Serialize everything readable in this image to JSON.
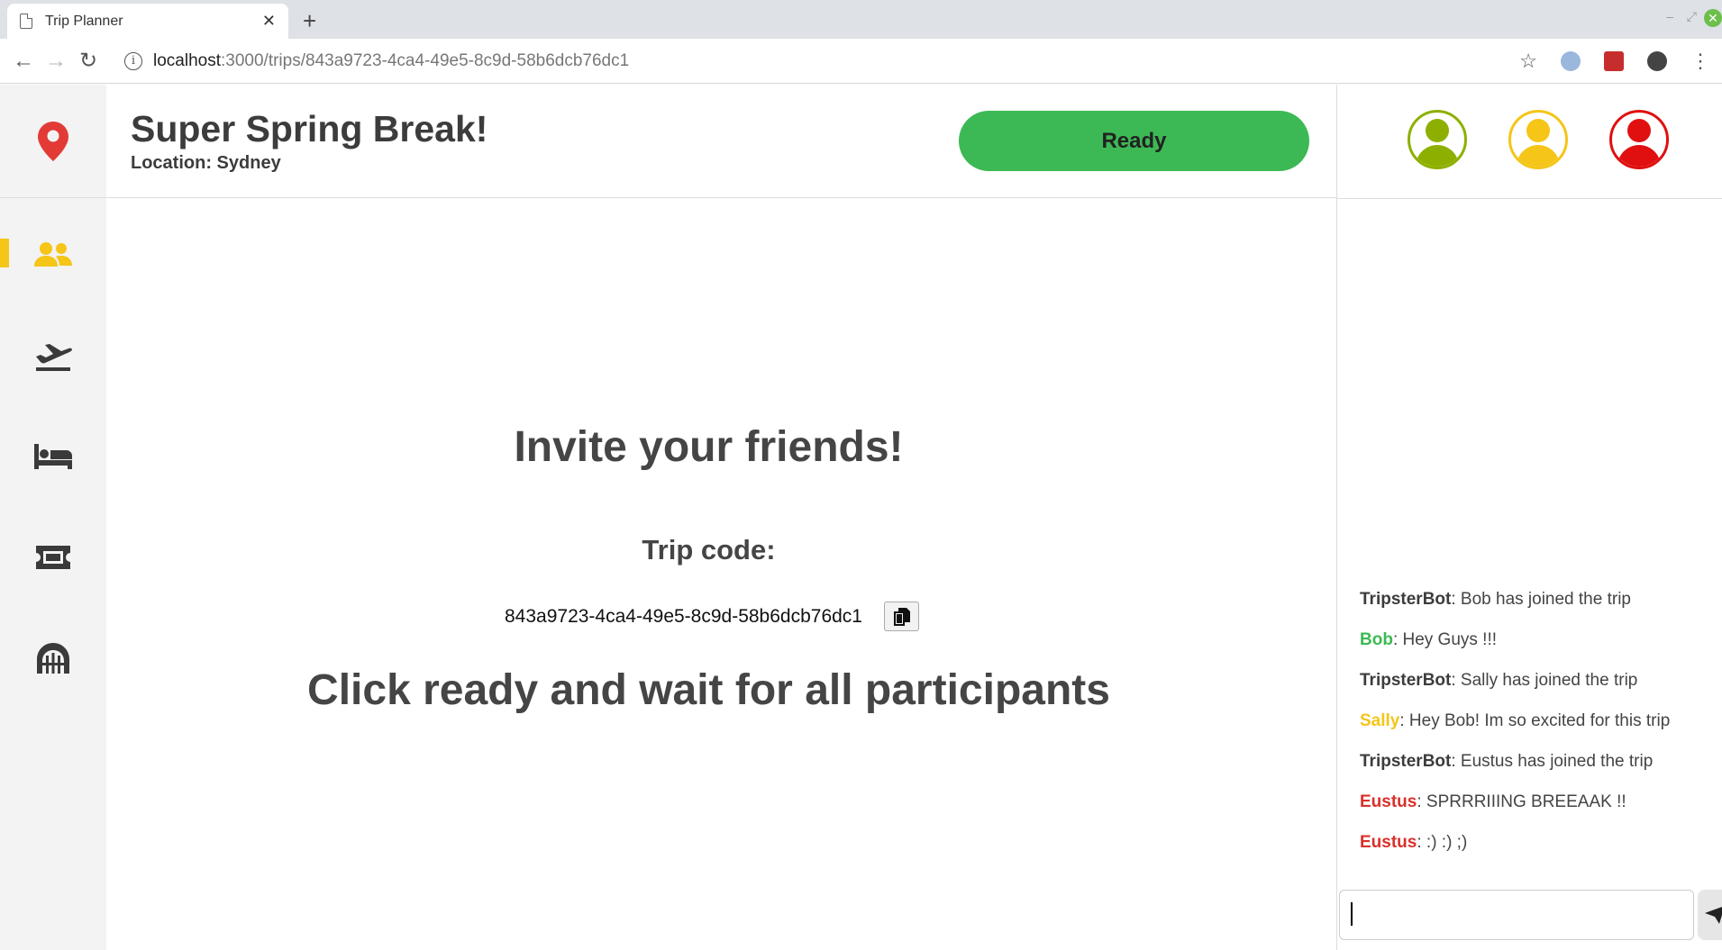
{
  "browser": {
    "tab_title": "Trip Planner",
    "tab_close": "✕",
    "new_tab": "+",
    "url_host": "localhost",
    "url_rest": ":3000/trips/843a9723-4ca4-49e5-8c9d-58b6dcb76dc1",
    "back": "←",
    "forward": "→",
    "reload": "↻",
    "info": "i",
    "star": "☆",
    "minimize": "–",
    "restore": "⤢",
    "close": "✕"
  },
  "colors": {
    "ready_green": "#3cb954",
    "accent_yellow": "#f5c518",
    "bob_green": "#8db000",
    "sally_yellow": "#f5c518",
    "eustus_red": "#e01010",
    "logo_red": "#e23b36"
  },
  "header": {
    "title": "Super Spring Break!",
    "location": "Location: Sydney",
    "ready_label": "Ready"
  },
  "sidebar": {
    "items": [
      {
        "icon": "users-icon",
        "active": true
      },
      {
        "icon": "airplane-icon",
        "active": false
      },
      {
        "icon": "bed-icon",
        "active": false
      },
      {
        "icon": "ticket-icon",
        "active": false
      },
      {
        "icon": "bridge-icon",
        "active": false
      }
    ]
  },
  "main": {
    "invite_heading": "Invite your friends!",
    "code_label": "Trip code:",
    "code_value": "843a9723-4ca4-49e5-8c9d-58b6dcb76dc1",
    "wait_message": "Click ready and wait for all participants"
  },
  "participants": [
    {
      "color": "#8db000"
    },
    {
      "color": "#f5c518"
    },
    {
      "color": "#e01010"
    }
  ],
  "chat": {
    "messages": [
      {
        "sender": "TripsterBot",
        "color": "#3c3c3c",
        "text": ": Bob has joined the trip"
      },
      {
        "sender": "Bob",
        "color": "#3cb954",
        "text": ": Hey Guys !!!"
      },
      {
        "sender": "TripsterBot",
        "color": "#3c3c3c",
        "text": ": Sally has joined the trip"
      },
      {
        "sender": "Sally",
        "color": "#f5c518",
        "text": ": Hey Bob! Im so excited for this trip"
      },
      {
        "sender": "TripsterBot",
        "color": "#3c3c3c",
        "text": ": Eustus has joined the trip"
      },
      {
        "sender": "Eustus",
        "color": "#d9302b",
        "text": ": SPRRRIIING BREEAAK !!"
      },
      {
        "sender": "Eustus",
        "color": "#d9302b",
        "text": ": :) :) ;)"
      }
    ],
    "input_value": ""
  }
}
